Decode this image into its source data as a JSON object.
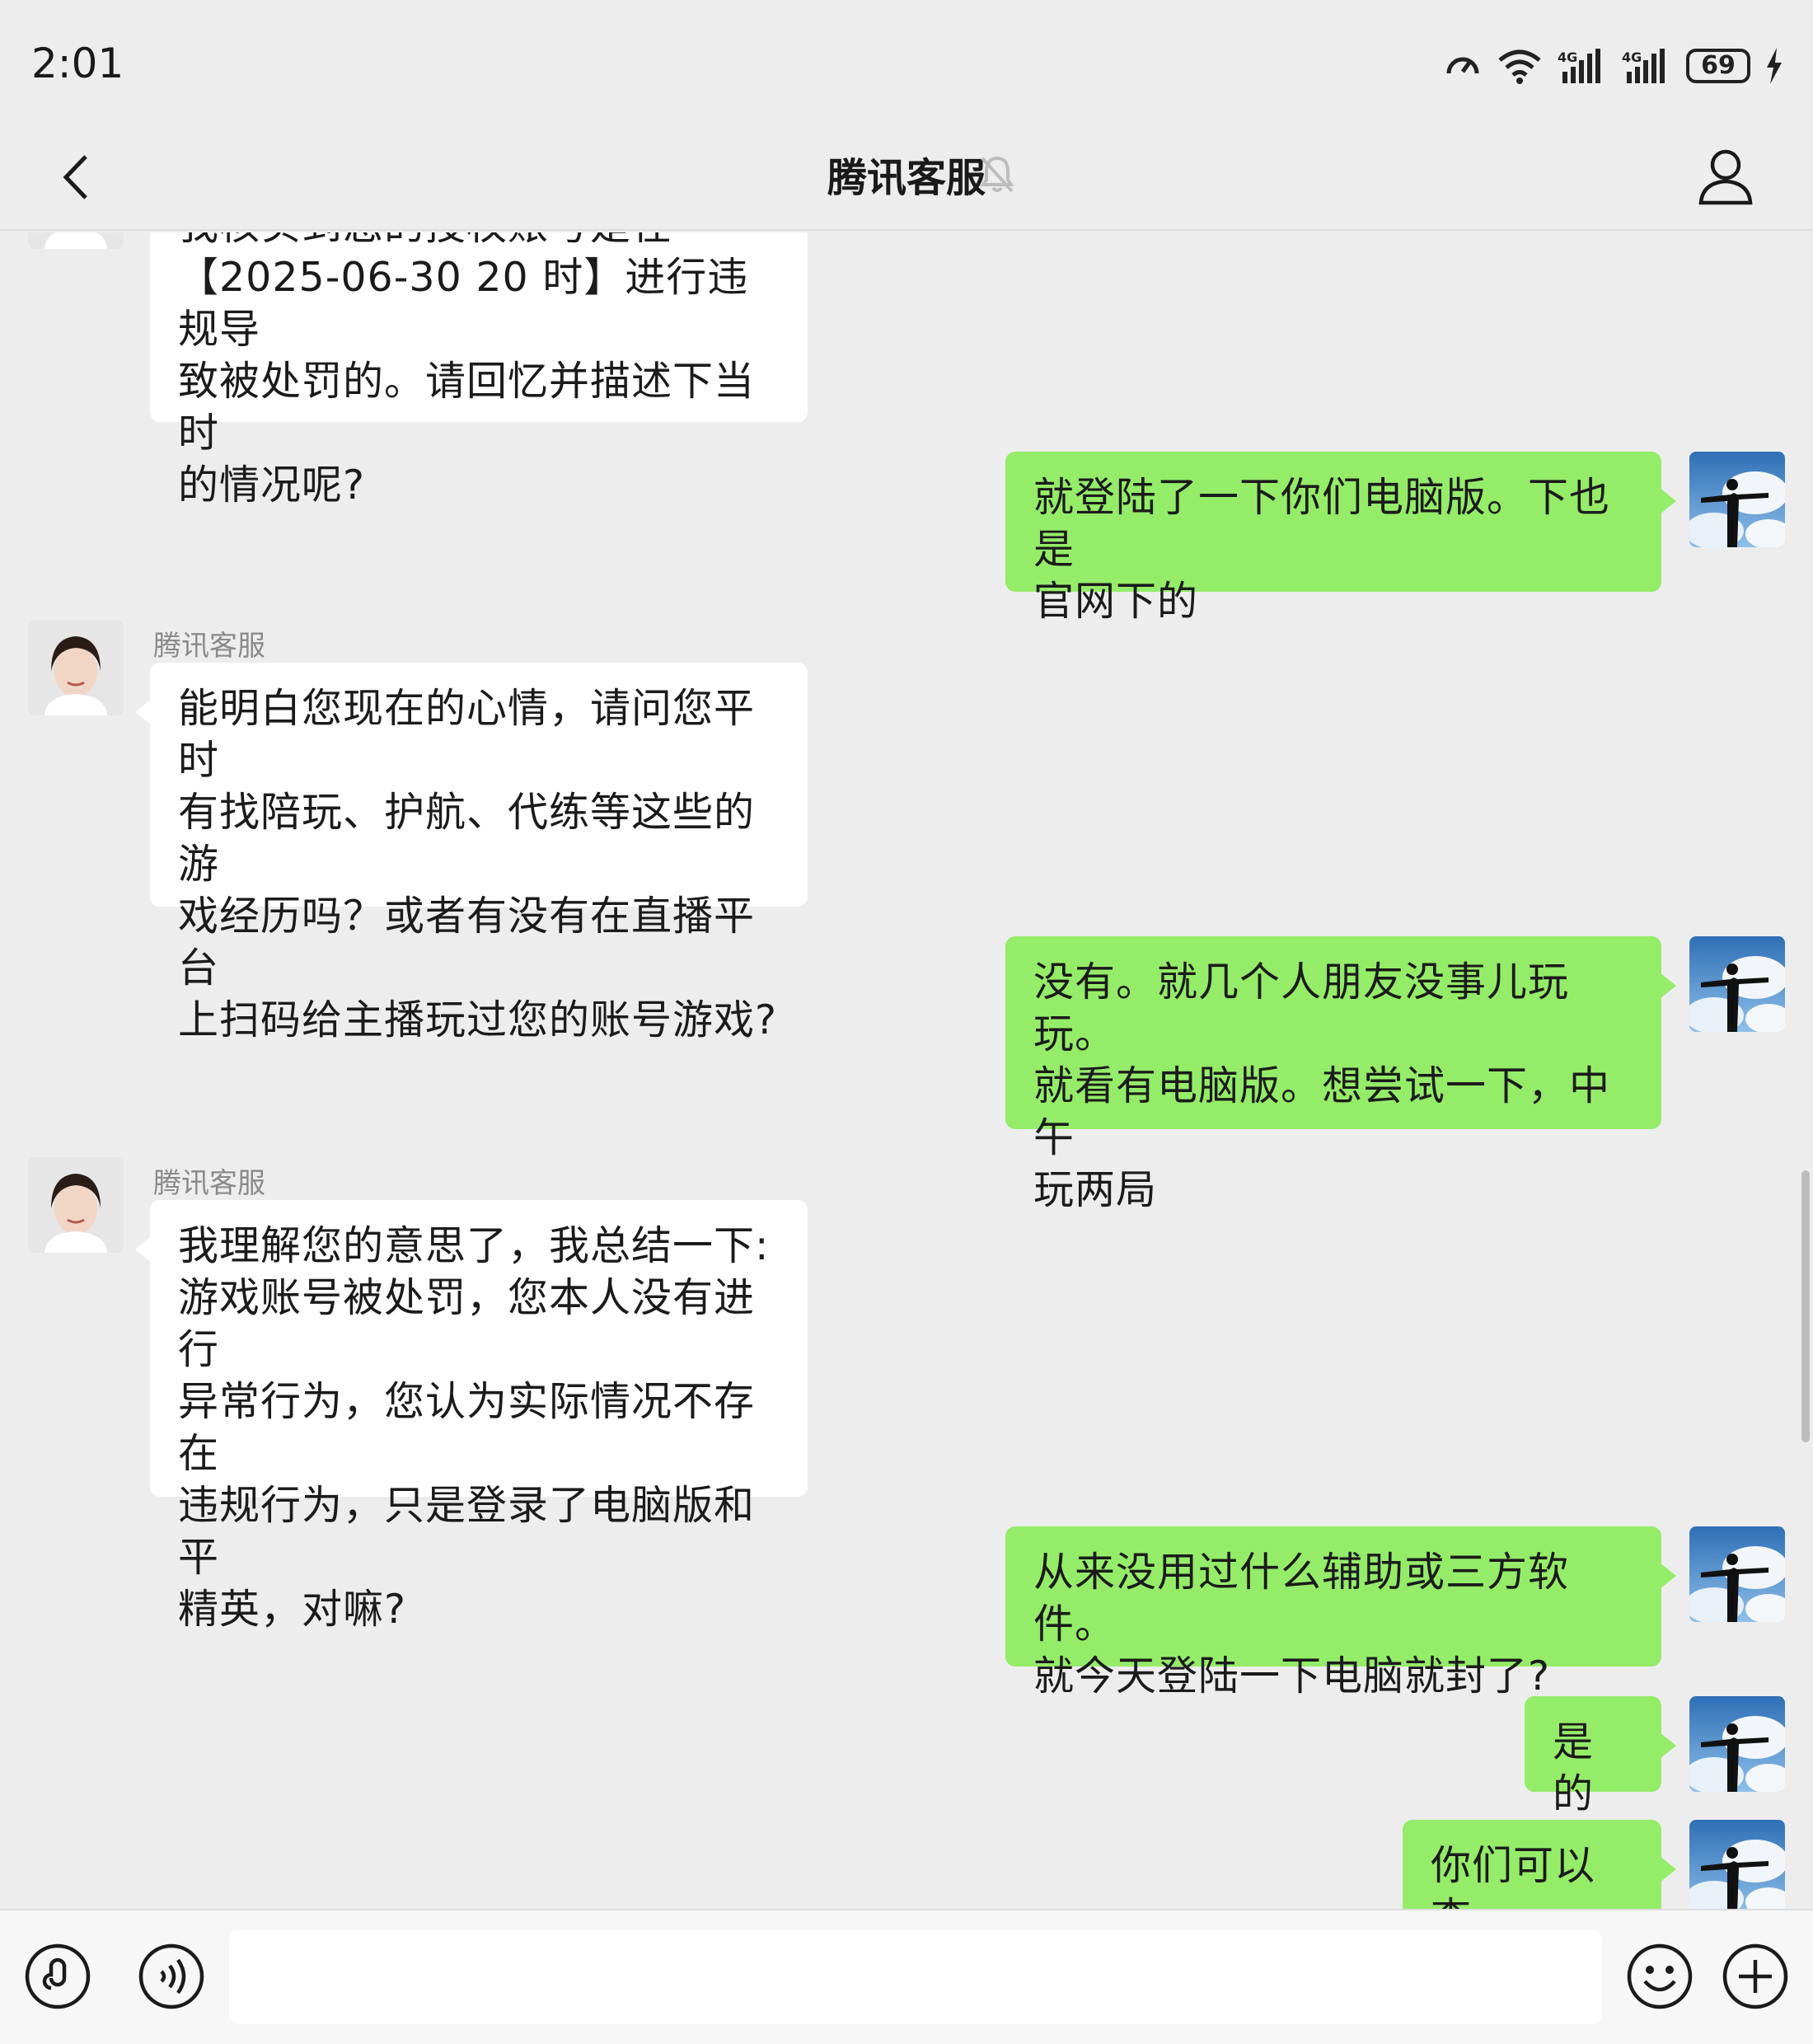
{
  "status": {
    "time": "2:01",
    "battery": "69"
  },
  "header": {
    "title": "腾讯客服"
  },
  "messages": [
    {
      "side": "in",
      "cut": true,
      "lines": [
        "我核实到您的授权账号是在",
        "【2025-06-30 20 时】进行违规导",
        "致被处罚的。请回忆并描述下当时",
        "的情况呢?"
      ]
    },
    {
      "side": "out",
      "lines": [
        "就登陆了一下你们电脑版。下也是",
        "官网下的"
      ]
    },
    {
      "side": "in",
      "sender": "腾讯客服",
      "lines": [
        "能明白您现在的心情，请问您平时",
        "有找陪玩、护航、代练等这些的游",
        "戏经历吗？或者有没有在直播平台",
        "上扫码给主播玩过您的账号游戏?"
      ]
    },
    {
      "side": "out",
      "lines": [
        "没有。就几个人朋友没事儿玩玩。",
        "就看有电脑版。想尝试一下，中午",
        "玩两局"
      ]
    },
    {
      "side": "in",
      "sender": "腾讯客服",
      "lines": [
        "我理解您的意思了，我总结一下:",
        "游戏账号被处罚，您本人没有进行",
        "异常行为，您认为实际情况不存在",
        "违规行为，只是登录了电脑版和平",
        "精英，对嘛?"
      ]
    },
    {
      "side": "out",
      "lines": [
        "从来没用过什么辅助或三方软件。",
        "就今天登陆一下电脑就封了?"
      ]
    },
    {
      "side": "out",
      "lines": [
        "是的"
      ]
    },
    {
      "side": "out",
      "lines": [
        "你们可以查"
      ]
    }
  ],
  "input": {
    "placeholder": ""
  },
  "colors": {
    "background": "#ededed",
    "incoming_bubble": "#ffffff",
    "outgoing_bubble": "#95ec69"
  }
}
